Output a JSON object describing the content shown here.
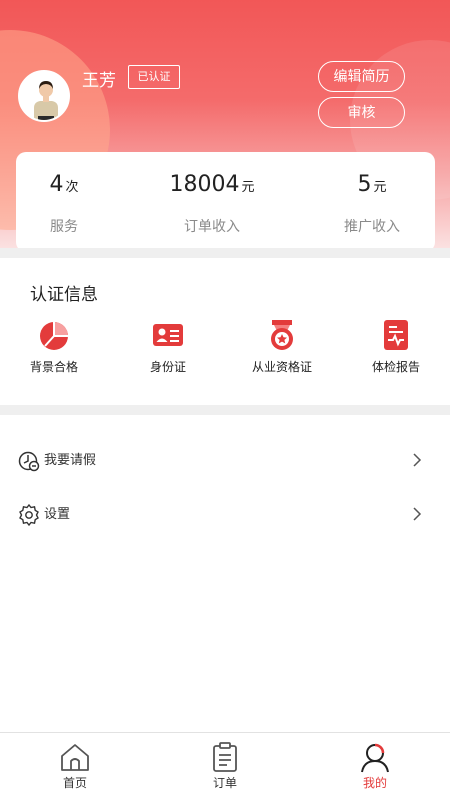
{
  "profile": {
    "name": "王芳",
    "badge": "已认证",
    "edit_resume_label": "编辑简历",
    "review_label": "审核"
  },
  "stats": [
    {
      "value": "4",
      "unit": "次",
      "label": "服务"
    },
    {
      "value": "18004",
      "unit": "元",
      "label": "订单收入"
    },
    {
      "value": "5",
      "unit": "元",
      "label": "推广收入"
    }
  ],
  "certification": {
    "title": "认证信息",
    "items": [
      {
        "label": "背景合格",
        "icon": "pie-chart-icon"
      },
      {
        "label": "身份证",
        "icon": "id-card-icon"
      },
      {
        "label": "从业资格证",
        "icon": "medal-icon"
      },
      {
        "label": "体检报告",
        "icon": "health-report-icon"
      }
    ]
  },
  "menu": [
    {
      "label": "我要请假",
      "icon": "leave-clock-icon"
    },
    {
      "label": "设置",
      "icon": "gear-icon"
    }
  ],
  "tabbar": [
    {
      "label": "首页",
      "icon": "home-icon"
    },
    {
      "label": "订单",
      "icon": "clipboard-icon"
    },
    {
      "label": "我的",
      "icon": "user-icon",
      "active": true
    }
  ],
  "colors": {
    "accent": "#e33b3b",
    "header_top": "#f25757"
  }
}
